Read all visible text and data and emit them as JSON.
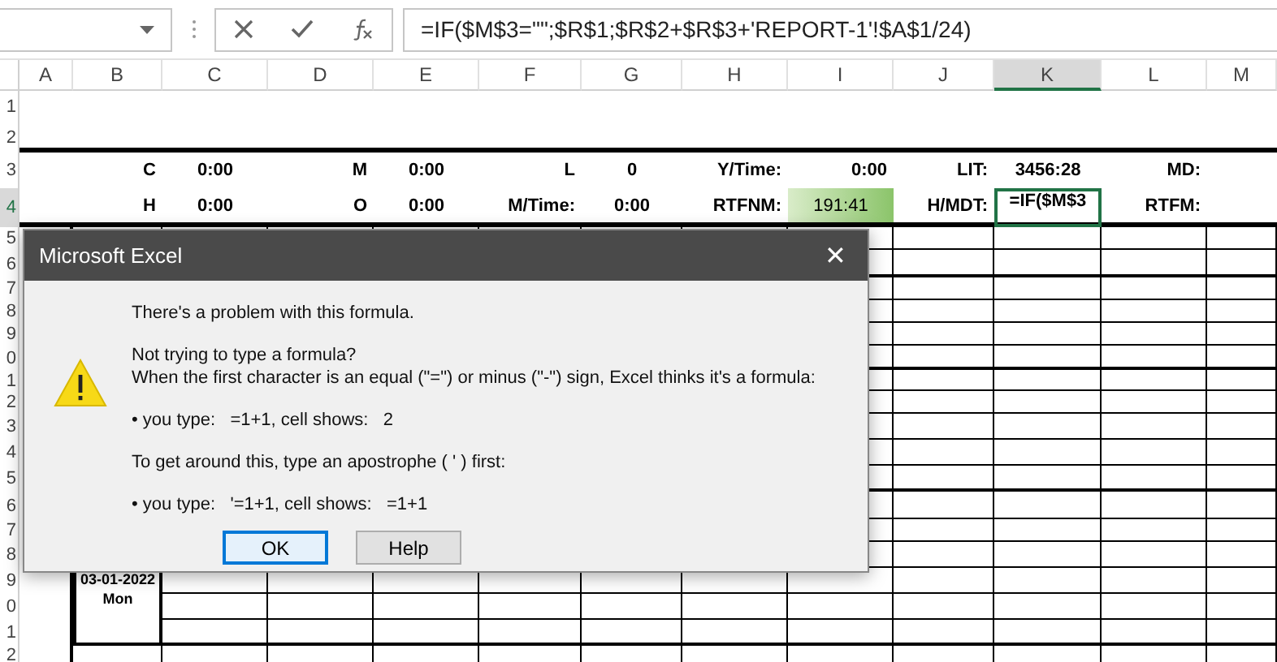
{
  "formula_bar": {
    "value": "=IF($M$3=\"\";$R$1;$R$2+$R$3+'REPORT-1'!$A$1/24)"
  },
  "columns": [
    {
      "label": "A",
      "selected": false
    },
    {
      "label": "B",
      "selected": false
    },
    {
      "label": "C",
      "selected": false
    },
    {
      "label": "D",
      "selected": false
    },
    {
      "label": "E",
      "selected": false
    },
    {
      "label": "F",
      "selected": false
    },
    {
      "label": "G",
      "selected": false
    },
    {
      "label": "H",
      "selected": false
    },
    {
      "label": "I",
      "selected": false
    },
    {
      "label": "J",
      "selected": false
    },
    {
      "label": "K",
      "selected": true
    },
    {
      "label": "L",
      "selected": false
    },
    {
      "label": "M",
      "selected": false
    }
  ],
  "row_headers": [
    {
      "label": "1",
      "selected": false
    },
    {
      "label": "2",
      "selected": false
    },
    {
      "label": "3",
      "selected": false
    },
    {
      "label": "4",
      "selected": true
    },
    {
      "label": "5",
      "selected": false
    },
    {
      "label": "6",
      "selected": false
    },
    {
      "label": "7",
      "selected": false
    },
    {
      "label": "8",
      "selected": false
    },
    {
      "label": "9",
      "selected": false
    },
    {
      "label": "0",
      "selected": false
    },
    {
      "label": "1",
      "selected": false
    },
    {
      "label": "2",
      "selected": false
    },
    {
      "label": "3",
      "selected": false
    },
    {
      "label": "4",
      "selected": false
    },
    {
      "label": "5",
      "selected": false
    },
    {
      "label": "6",
      "selected": false
    },
    {
      "label": "7",
      "selected": false
    },
    {
      "label": "8",
      "selected": false
    },
    {
      "label": "9",
      "selected": false
    },
    {
      "label": "0",
      "selected": false
    },
    {
      "label": "1",
      "selected": false
    },
    {
      "label": "2",
      "selected": false
    }
  ],
  "summary_rows": [
    [
      {
        "text": "C",
        "kind": "label",
        "selected": false
      },
      {
        "text": "0:00",
        "kind": "value",
        "selected": false
      },
      {
        "text": "M",
        "kind": "label",
        "selected": false
      },
      {
        "text": "0:00",
        "kind": "value",
        "selected": false
      },
      {
        "text": "L",
        "kind": "label",
        "selected": false
      },
      {
        "text": "0",
        "kind": "value",
        "selected": false
      },
      {
        "text": "Y/Time:",
        "kind": "label",
        "selected": false
      },
      {
        "text": "0:00",
        "kind": "label",
        "selected": false
      },
      {
        "text": "LIT:",
        "kind": "label",
        "selected": false
      },
      {
        "text": "3456:28",
        "kind": "value",
        "selected": false
      },
      {
        "text": "MD:",
        "kind": "label",
        "selected": false
      },
      {
        "text": null,
        "kind": "value",
        "selected": false
      }
    ],
    [
      {
        "text": "H",
        "kind": "label",
        "selected": false
      },
      {
        "text": "0:00",
        "kind": "value",
        "selected": false
      },
      {
        "text": "O",
        "kind": "label",
        "selected": false
      },
      {
        "text": "0:00",
        "kind": "value",
        "selected": false
      },
      {
        "text": "M/Time:",
        "kind": "label",
        "selected": false
      },
      {
        "text": "0:00",
        "kind": "value",
        "selected": false
      },
      {
        "text": "RTFNM:",
        "kind": "label",
        "selected": false
      },
      {
        "text": "191:41",
        "kind": "good",
        "selected": false
      },
      {
        "text": "H/MDT:",
        "kind": "label",
        "selected": false
      },
      {
        "text": "=IF($M$3",
        "kind": "formula",
        "selected": true
      },
      {
        "text": "RTFM:",
        "kind": "label",
        "selected": false
      },
      {
        "text": null,
        "kind": "value",
        "selected": false
      }
    ]
  ],
  "date_cell": {
    "date": "03-01-2022",
    "day": "Mon"
  },
  "dialog": {
    "title": "Microsoft Excel",
    "close": "✕",
    "paragraphs": [
      [
        "There's a problem with this formula."
      ],
      [
        "Not trying to type a formula?",
        "When the first character is an equal (\"=\") or minus (\"-\") sign, Excel thinks it's a formula:"
      ],
      [
        "• you type:   =1+1, cell shows:   2"
      ],
      [
        "To get around this, type an apostrophe ( ' ) first:"
      ],
      [
        "• you type:   '=1+1, cell shows:   =1+1"
      ]
    ],
    "buttons": [
      {
        "label": "OK",
        "default": true
      },
      {
        "label": "Help",
        "default": false
      }
    ]
  }
}
